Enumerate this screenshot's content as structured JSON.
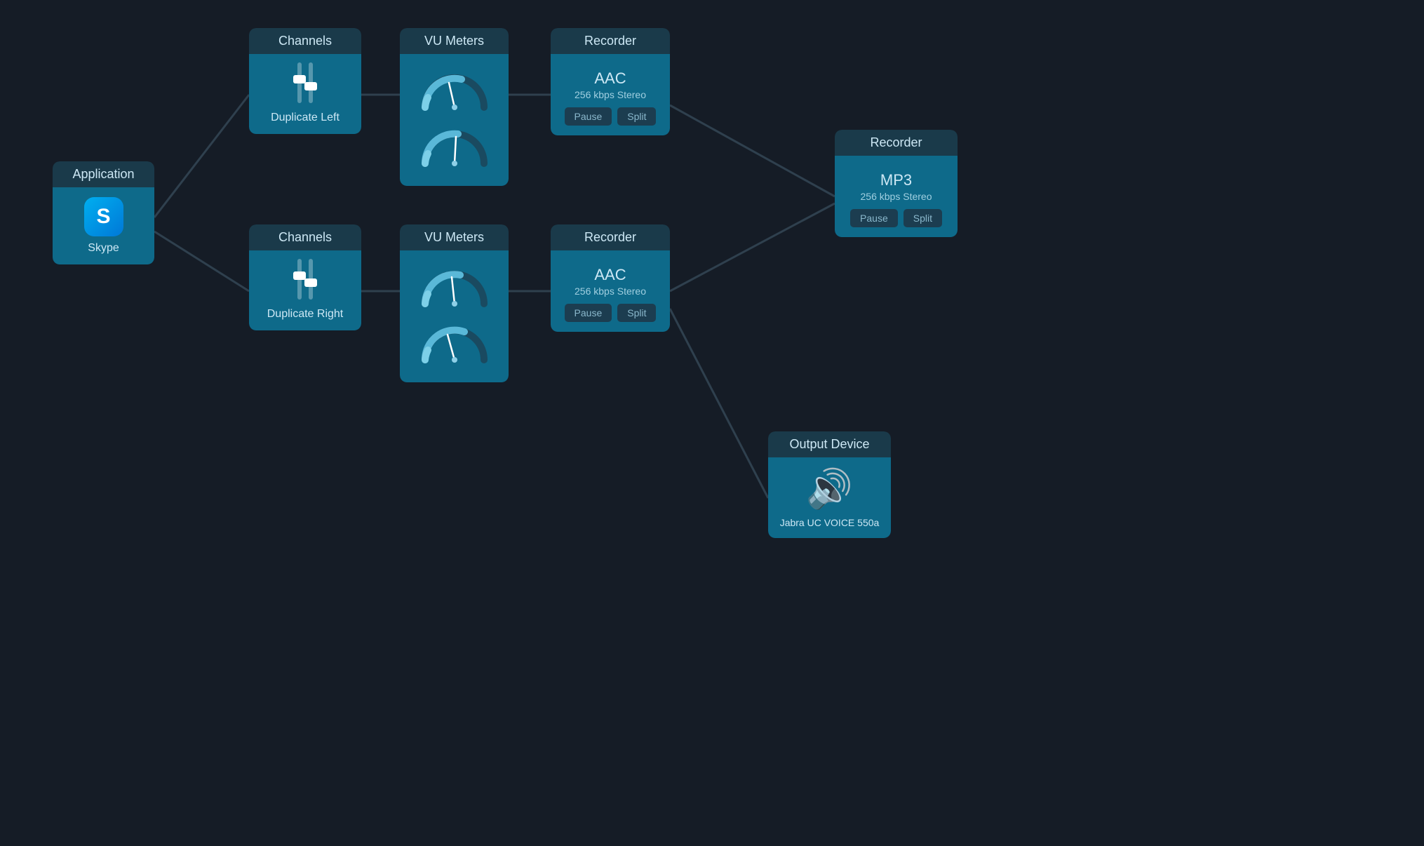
{
  "app": {
    "skype": {
      "header": "Application",
      "label": "Skype"
    },
    "ch_left": {
      "header": "Channels",
      "label": "Duplicate Left"
    },
    "vu_left": {
      "header": "VU Meters"
    },
    "rec_aac_left": {
      "header": "Recorder",
      "format": "AAC",
      "quality": "256 kbps Stereo",
      "btn_pause": "Pause",
      "btn_split": "Split"
    },
    "ch_right": {
      "header": "Channels",
      "label": "Duplicate Right"
    },
    "vu_right": {
      "header": "VU Meters"
    },
    "rec_aac_right": {
      "header": "Recorder",
      "format": "AAC",
      "quality": "256 kbps Stereo",
      "btn_pause": "Pause",
      "btn_split": "Split"
    },
    "rec_mp3": {
      "header": "Recorder",
      "format": "MP3",
      "quality": "256 kbps Stereo",
      "btn_pause": "Pause",
      "btn_split": "Split"
    },
    "output": {
      "header": "Output Device",
      "label": "Jabra UC VOICE 550a"
    }
  },
  "colors": {
    "bg": "#151c26",
    "node_header_bg": "#1a3a4a",
    "node_body_bg": "#0e6a8a",
    "connection_line": "#3a5060"
  }
}
